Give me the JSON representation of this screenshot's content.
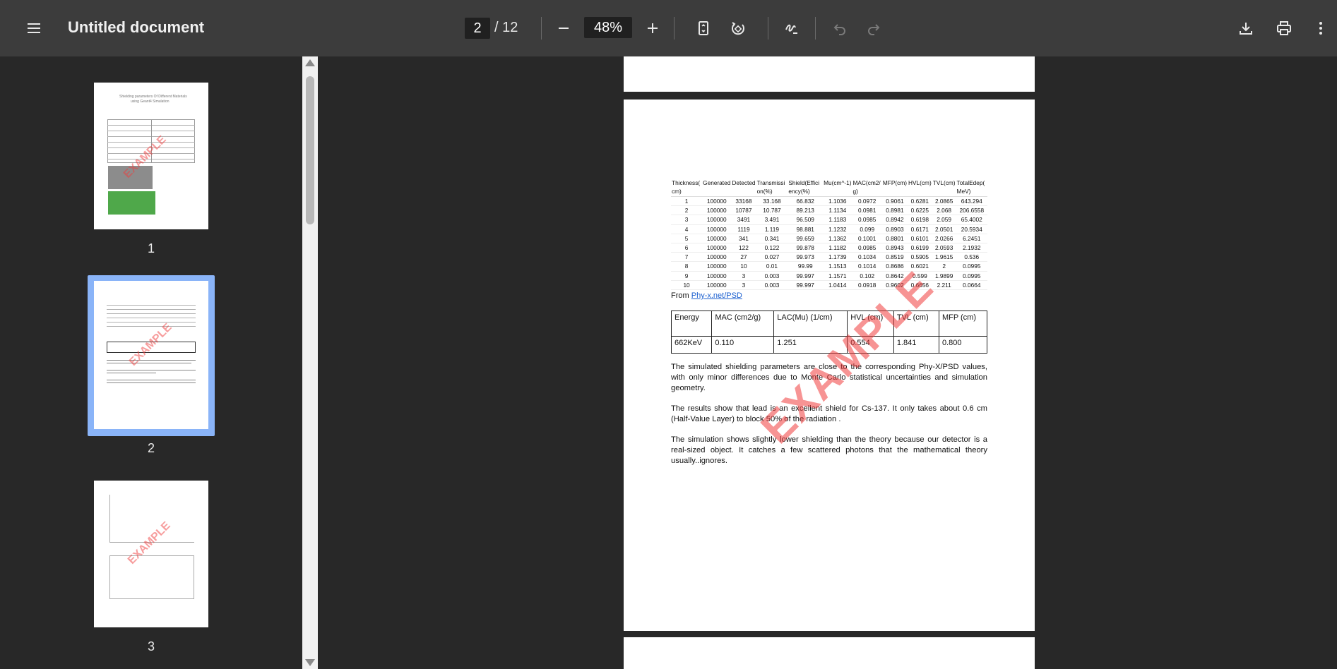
{
  "toolbar": {
    "menu_icon": "menu-icon",
    "title": "Untitled document",
    "page_current": "2",
    "page_total": "/ 12",
    "zoom": "48%",
    "icons": [
      "zoom-out-icon",
      "zoom-in-icon",
      "fit-page-icon",
      "rotate-icon",
      "annotate-icon",
      "undo-icon",
      "redo-icon",
      "download-icon",
      "print-icon",
      "more-icon"
    ]
  },
  "sidebar": {
    "thumbnails": [
      {
        "label": "1",
        "title_line1": "Shielding parameters Of Different Materials",
        "title_line2": "using Geant4 Simulation"
      },
      {
        "label": "2"
      },
      {
        "label": "3"
      }
    ],
    "watermark": "EXAMPLE"
  },
  "document": {
    "table_headers": [
      "Thickness(cm)",
      "Generated",
      "Detected",
      "Transmission(%)",
      "ShieldEfficiency(%)",
      "Mu(cm^-1)",
      "MAC(cm2/g)",
      "MFP(cm)",
      "HVL(cm)",
      "TVL(cm)",
      "TotalEdep(MeV)"
    ],
    "table_headers_display": [
      "Thickness( cm)",
      "Generated",
      "Detected",
      "Transmissi on(%)",
      "Shield(Effici ency(%)",
      "Mu(cm^-1)",
      "MAC(cm2/ g)",
      "MFP(cm)",
      "HVL(cm)",
      "TVL(cm)",
      "TotalEdep( MeV)"
    ],
    "table_rows": [
      [
        "1",
        "100000",
        "33168",
        "33.168",
        "66.832",
        "1.1036",
        "0.0972",
        "0.9061",
        "0.6281",
        "2.0865",
        "643.294"
      ],
      [
        "2",
        "100000",
        "10787",
        "10.787",
        "89.213",
        "1.1134",
        "0.0981",
        "0.8981",
        "0.6225",
        "2.068",
        "206.6558"
      ],
      [
        "3",
        "100000",
        "3491",
        "3.491",
        "96.509",
        "1.1183",
        "0.0985",
        "0.8942",
        "0.6198",
        "2.059",
        "65.4002"
      ],
      [
        "4",
        "100000",
        "1119",
        "1.119",
        "98.881",
        "1.1232",
        "0.099",
        "0.8903",
        "0.6171",
        "2.0501",
        "20.5934"
      ],
      [
        "5",
        "100000",
        "341",
        "0.341",
        "99.659",
        "1.1362",
        "0.1001",
        "0.8801",
        "0.6101",
        "2.0266",
        "6.2451"
      ],
      [
        "6",
        "100000",
        "122",
        "0.122",
        "99.878",
        "1.1182",
        "0.0985",
        "0.8943",
        "0.6199",
        "2.0593",
        "2.1932"
      ],
      [
        "7",
        "100000",
        "27",
        "0.027",
        "99.973",
        "1.1739",
        "0.1034",
        "0.8519",
        "0.5905",
        "1.9615",
        "0.536"
      ],
      [
        "8",
        "100000",
        "10",
        "0.01",
        "99.99",
        "1.1513",
        "0.1014",
        "0.8686",
        "0.6021",
        "2",
        "0.0995"
      ],
      [
        "9",
        "100000",
        "3",
        "0.003",
        "99.997",
        "1.1571",
        "0.102",
        "0.8642",
        "0.599",
        "1.9899",
        "0.0995"
      ],
      [
        "10",
        "100000",
        "3",
        "0.003",
        "99.997",
        "1.0414",
        "0.0918",
        "0.9602",
        "0.6656",
        "2.211",
        "0.0664"
      ]
    ],
    "from_prefix": "From ",
    "from_link": "Phy-x.net/PSD",
    "ref_headers": [
      "Energy",
      "MAC (cm2/g)",
      "LAC(Mu) (1/cm)",
      "HVL (cm)",
      "TVL (cm)",
      "MFP (cm)"
    ],
    "ref_values": [
      "662KeV",
      "0.110",
      "1.251",
      "0.554",
      "1.841",
      "0.800"
    ],
    "paragraphs": [
      "The simulated shielding parameters are close to the corresponding Phy-X/PSD values, with only minor differences due to Monte Carlo statistical uncertainties and simulation geometry.",
      "The results show that lead is an excellent shield for Cs-137. It only takes about 0.6 cm (Half-Value Layer) to block 50% of the radiation .",
      "The simulation shows slightly lower shielding than the theory because our detector is a real-sized object. It catches a few scattered photons that the mathematical theory usually..ignores."
    ],
    "watermark": "EXAMPLE"
  },
  "colors": {
    "toolbar_bg": "#3c3c3c",
    "viewer_bg": "#282828",
    "selection": "#8ab4f8",
    "watermark": "#f03c3c",
    "link": "#1a5fd0"
  }
}
